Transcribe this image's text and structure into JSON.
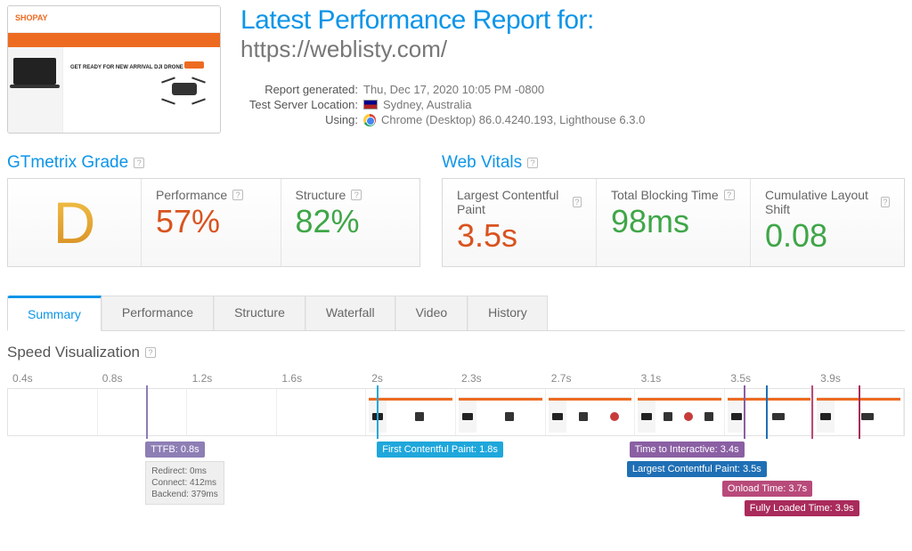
{
  "header": {
    "title": "Latest Performance Report for:",
    "url": "https://weblisty.com/",
    "thumb": {
      "brand": "SHOPAY",
      "hero_line": "GET READY FOR NEW ARRIVAL DJI DRONE"
    }
  },
  "meta": {
    "generated_label": "Report generated",
    "generated_value": "Thu, Dec 17, 2020 10:05 PM -0800",
    "server_label": "Test Server Location",
    "server_value": "Sydney, Australia",
    "using_label": "Using",
    "using_value": "Chrome (Desktop) 86.0.4240.193, Lighthouse 6.3.0"
  },
  "sections": {
    "grade_title": "GTmetrix Grade",
    "vitals_title": "Web Vitals"
  },
  "grade": {
    "letter": "D",
    "performance_label": "Performance",
    "performance_value": "57%",
    "structure_label": "Structure",
    "structure_value": "82%"
  },
  "vitals": {
    "lcp_label": "Largest Contentful Paint",
    "lcp_value": "3.5s",
    "tbt_label": "Total Blocking Time",
    "tbt_value": "98ms",
    "cls_label": "Cumulative Layout Shift",
    "cls_value": "0.08"
  },
  "tabs": {
    "summary": "Summary",
    "performance": "Performance",
    "structure": "Structure",
    "waterfall": "Waterfall",
    "video": "Video",
    "history": "History"
  },
  "speed": {
    "title": "Speed Visualization",
    "ticks": [
      "0.4s",
      "0.8s",
      "1.2s",
      "1.6s",
      "2s",
      "2.3s",
      "2.7s",
      "3.1s",
      "3.5s",
      "3.9s"
    ],
    "markers": {
      "ttfb": "TTFB: 0.8s",
      "ttfb_detail_redirect": "Redirect: 0ms",
      "ttfb_detail_connect": "Connect: 412ms",
      "ttfb_detail_backend": "Backend: 379ms",
      "fcp": "First Contentful Paint: 1.8s",
      "tti": "Time to Interactive: 3.4s",
      "lcp": "Largest Contentful Paint: 3.5s",
      "onload": "Onload Time: 3.7s",
      "full": "Fully Loaded Time: 3.9s"
    }
  },
  "chart_data": {
    "type": "table",
    "title": "Speed Visualization timeline markers",
    "timeline_range_s": [
      0,
      3.9
    ],
    "tick_marks_s": [
      0.4,
      0.8,
      1.2,
      1.6,
      2.0,
      2.3,
      2.7,
      3.1,
      3.5,
      3.9
    ],
    "events": [
      {
        "name": "TTFB",
        "time_s": 0.8,
        "breakdown": {
          "redirect_ms": 0,
          "connect_ms": 412,
          "backend_ms": 379
        }
      },
      {
        "name": "First Contentful Paint",
        "time_s": 1.8
      },
      {
        "name": "Time to Interactive",
        "time_s": 3.4
      },
      {
        "name": "Largest Contentful Paint",
        "time_s": 3.5
      },
      {
        "name": "Onload Time",
        "time_s": 3.7
      },
      {
        "name": "Fully Loaded Time",
        "time_s": 3.9
      }
    ],
    "filmstrip_filled_from_tick_index": 4
  }
}
